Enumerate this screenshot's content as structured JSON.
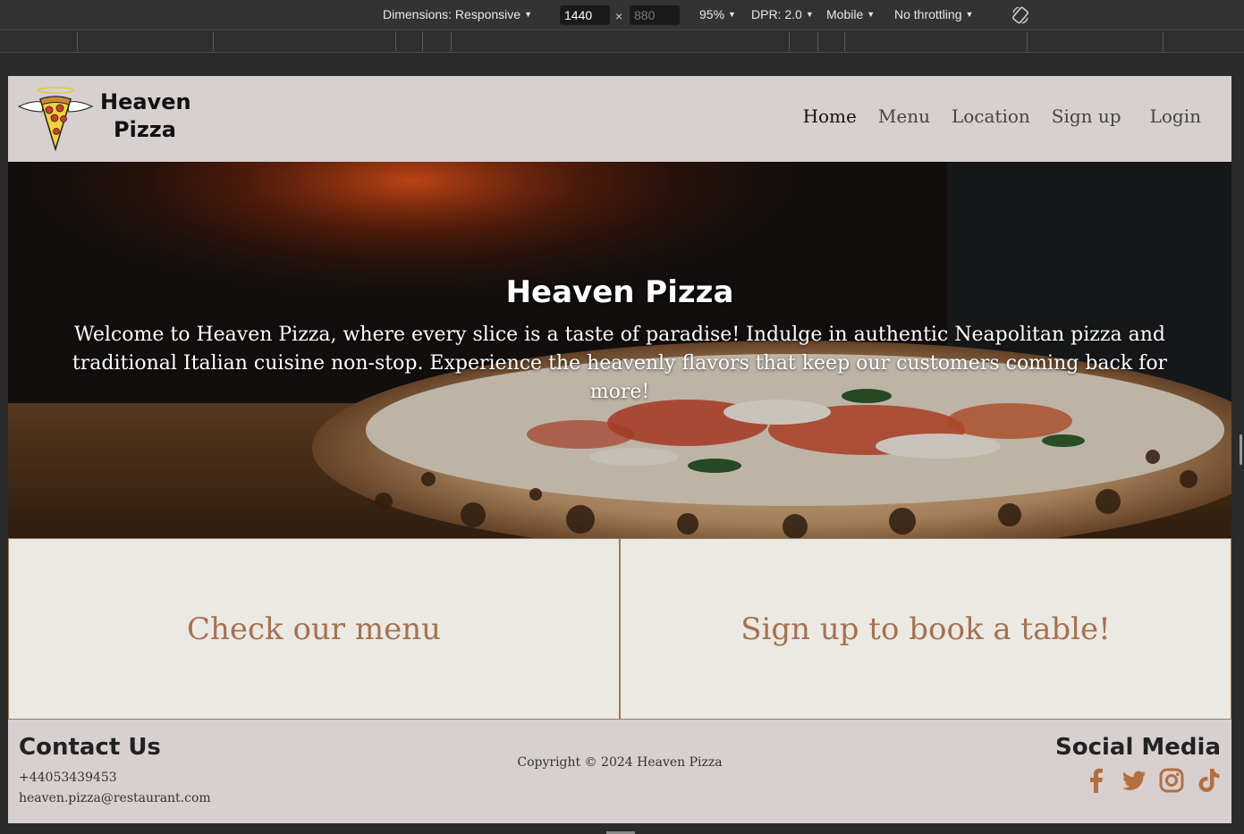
{
  "devtools": {
    "dimensions_label": "Dimensions: Responsive",
    "width_value": "1440",
    "height_placeholder": "880",
    "times": "×",
    "zoom": "95%",
    "dpr": "DPR: 2.0",
    "device_mode": "Mobile",
    "throttling": "No throttling",
    "rotate_icon": "rotate-icon"
  },
  "header": {
    "logo_icon": "angel-pizza-logo",
    "brand_line1": "Heaven",
    "brand_line2": "Pizza",
    "nav": {
      "home": "Home",
      "menu": "Menu",
      "location": "Location",
      "signup": "Sign up",
      "login": "Login"
    }
  },
  "hero": {
    "title": "Heaven Pizza",
    "text": "Welcome to Heaven Pizza, where every slice is a taste of paradise! Indulge in authentic Neapolitan pizza and traditional Italian cuisine non-stop. Experience the heavenly flavors that keep our customers coming back for more!"
  },
  "cards": {
    "menu": "Check our menu",
    "book": "Sign up to book a table!"
  },
  "footer": {
    "contact_title": "Contact Us",
    "phone": "+44053439453",
    "email": "heaven.pizza@restaurant.com",
    "copyright": "Copyright © 2024 Heaven Pizza",
    "social_title": "Social Media",
    "social_icons": [
      "facebook-icon",
      "twitter-icon",
      "instagram-icon",
      "tiktok-icon"
    ],
    "accent_color": "#b3703f"
  }
}
